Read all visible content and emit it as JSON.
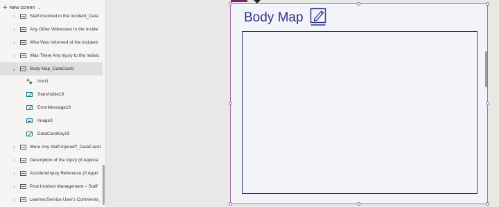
{
  "tree": {
    "new_screen_label": "New screen",
    "rows": [
      {
        "label": "Staff Involved in the Incident_Data",
        "type": "card"
      },
      {
        "label": "Any Other Witnesses to the Incide",
        "type": "card"
      },
      {
        "label": "Who Was Informed of the Incident",
        "type": "card"
      },
      {
        "label": "Was There Any Injury to the Indivic",
        "type": "card"
      },
      {
        "label": "Body Map_DataCard1",
        "type": "card",
        "expanded": true,
        "selected": true
      },
      {
        "label": "Icon1",
        "type": "icon",
        "child": true
      },
      {
        "label": "StarVisible19",
        "type": "pencil",
        "child": true
      },
      {
        "label": "ErrorMessage19",
        "type": "pencil",
        "child": true
      },
      {
        "label": "Image3",
        "type": "image",
        "child": true
      },
      {
        "label": "DataCardKey19",
        "type": "pencil",
        "child": true
      },
      {
        "label": "Were Any Staff Injured?_DataCard1",
        "type": "card"
      },
      {
        "label": "Description of the Injury (If Applica",
        "type": "card"
      },
      {
        "label": "Accident/Injury Reference (If Appli",
        "type": "card"
      },
      {
        "label": "Post Incident Management – Staff",
        "type": "card"
      },
      {
        "label": "Learner/Service User's Comments_",
        "type": "card"
      }
    ]
  },
  "card": {
    "title": "Body Map",
    "edit_icon": "edit-note-icon"
  },
  "colors": {
    "accent": "#2d3486",
    "selection": "#a06aa8",
    "tree_selected": "#e1dfdd"
  }
}
